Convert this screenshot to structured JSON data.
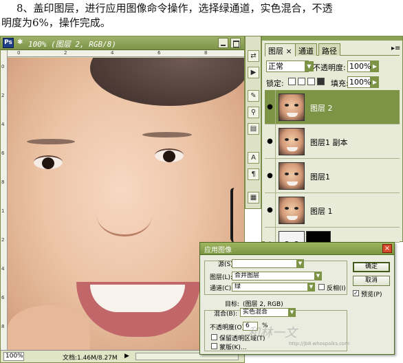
{
  "instruction": {
    "line1": "8、盖印图层，进行应用图像命令操作，选择绿通道，实色混合，不透",
    "line2": "明度为6%，操作完成。"
  },
  "document": {
    "title": "100% (图层 2, RGB/8)",
    "status_zoom": "100%",
    "status_info": "文档:1.46M/8.27M",
    "ruler_top": [
      "0",
      "2",
      "4",
      "6",
      "8"
    ],
    "ruler_left": [
      "0",
      "2",
      "4",
      "6",
      "8",
      "1",
      "2",
      "4",
      "6",
      "8"
    ]
  },
  "tools": [
    "move-icon",
    "play-icon",
    "brush-icon",
    "stamp-icon",
    "eraser-icon",
    "text-icon",
    "paragraph-icon",
    "layers-icon"
  ],
  "layers_panel": {
    "tabs": [
      {
        "label": "图层 ×",
        "active": true
      },
      {
        "label": "通道",
        "active": false
      },
      {
        "label": "路径",
        "active": false
      }
    ],
    "blend_mode": "正常",
    "opacity_label": "不透明度:",
    "opacity": "100%",
    "lock_label": "锁定:",
    "fill_label": "填充:",
    "fill": "100%",
    "layers": [
      {
        "name": "图层 2",
        "selected": true
      },
      {
        "name": "图层1 副本",
        "selected": false
      },
      {
        "name": "图层1",
        "selected": false
      },
      {
        "name": "图层 1",
        "selected": false
      },
      {
        "name": "",
        "selected": false
      }
    ]
  },
  "apply_image": {
    "title": "应用图像",
    "source_label": "源(S):",
    "source_value": "",
    "layer_label": "图层(L):",
    "layer_value": "合并图层",
    "channel_label": "通道(C):",
    "channel_value": "绿",
    "invert_label": "反相(I)",
    "target_label": "目标:",
    "target_value": "(图层 2, RGB)",
    "blending_label": "混合(B):",
    "blending_value": "实色混合",
    "opacity_label": "不透明度(O):",
    "opacity_value": "6",
    "opacity_unit": "%",
    "preserve_label": "保留透明区域(T)",
    "mask_label": "蒙版(K)...",
    "ok_label": "确定",
    "cancel_label": "取消",
    "preview_label": "预览(P)",
    "preview_checked": true
  },
  "watermark": {
    "text": "和林一文",
    "url": "http://jb8.whospalks.com"
  }
}
